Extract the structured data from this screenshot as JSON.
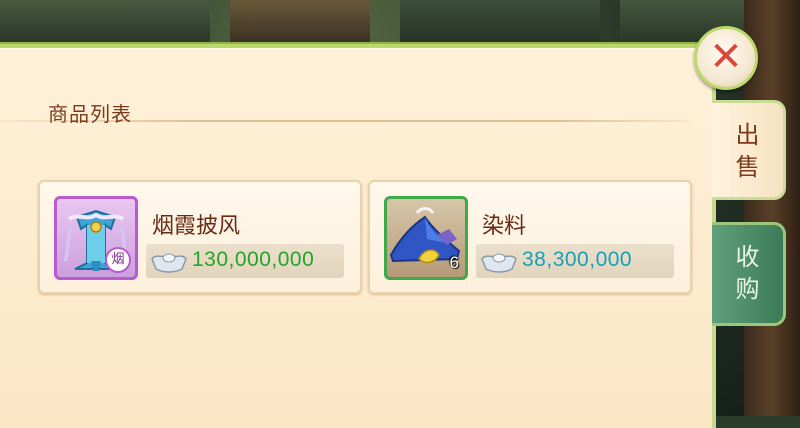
{
  "panel": {
    "section_title": "商品列表"
  },
  "items": [
    {
      "name": "烟霞披风",
      "price": "130,000,000",
      "badge": "烟",
      "icon": "cape-icon",
      "rarity_color": "#b95ad0"
    },
    {
      "name": "染料",
      "price": "38,300,000",
      "stack_count": "6",
      "icon": "dye-icon",
      "rarity_color": "#3fa848"
    }
  ],
  "tabs": {
    "sell": "出售",
    "buy": "收购"
  },
  "close_icon": "close-icon",
  "currency_icon": "silver-ingot-icon",
  "colors": {
    "price_primary": "#2aa02a",
    "price_secondary": "#1f9bb0",
    "title": "#7a3b1c"
  }
}
